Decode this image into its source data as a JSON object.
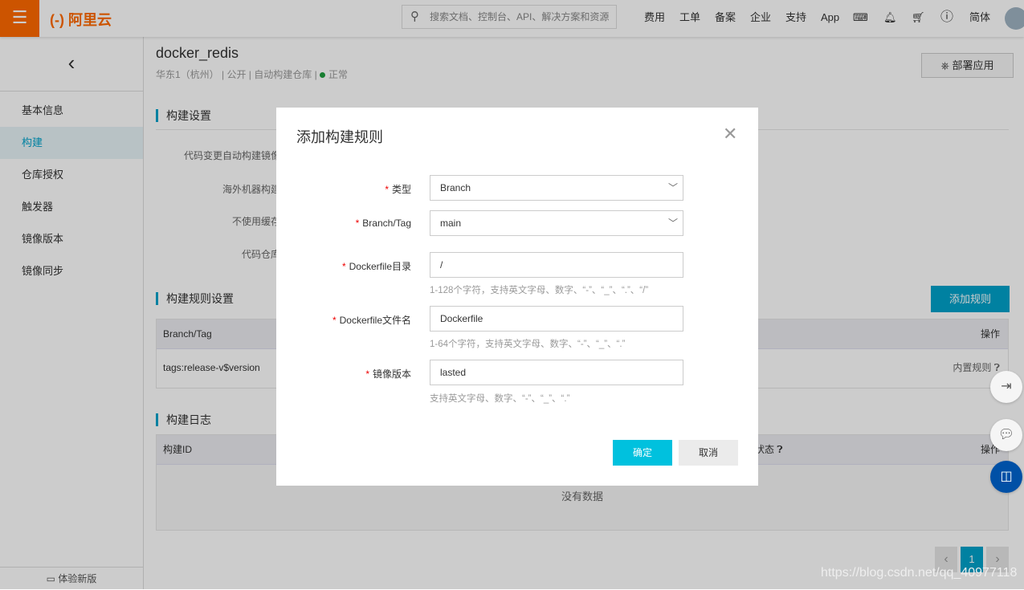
{
  "header": {
    "logo": "(-) 阿里云",
    "search_placeholder": "搜索文档、控制台、API、解决方案和资源",
    "nav": [
      "费用",
      "工单",
      "备案",
      "企业",
      "支持",
      "App"
    ],
    "lang": "简体"
  },
  "sidebar": {
    "items": [
      "基本信息",
      "构建",
      "仓库授权",
      "触发器",
      "镜像版本",
      "镜像同步"
    ],
    "active": "构建",
    "new_version": "体验新版"
  },
  "repo": {
    "name": "docker_redis",
    "meta": "华东1（杭州） | 公开 | 自动构建仓库 |",
    "status": "正常",
    "status_color": "#1e9e3e",
    "deploy": "部署应用"
  },
  "build_settings": {
    "title": "构建设置",
    "labels": [
      "代码变更自动构建镜像",
      "海外机器构建",
      "不使用缓存",
      "代码仓库"
    ]
  },
  "rules": {
    "title": "构建规则设置",
    "add": "添加规则",
    "columns": [
      "Branch/Tag",
      "操作"
    ],
    "rows": [
      {
        "branch": "tags:release-v$version",
        "op": "内置规则"
      }
    ]
  },
  "logs": {
    "title": "构建日志",
    "columns": [
      "构建ID",
      "状态",
      "操作"
    ],
    "empty": "没有数据"
  },
  "pagination": {
    "current": "1"
  },
  "watermark": "https://blog.csdn.net/qq_40977118",
  "modal": {
    "title": "添加构建规则",
    "fields": [
      {
        "label": "类型",
        "value": "Branch"
      },
      {
        "label": "Branch/Tag",
        "value": "main"
      },
      {
        "label": "Dockerfile目录",
        "value": "/",
        "hint": "1-128个字符，支持英文字母、数字、“-”、“_”、“.”、“/”"
      },
      {
        "label": "Dockerfile文件名",
        "value": "Dockerfile",
        "hint": "1-64个字符，支持英文字母、数字、“-”、“_”、“.”"
      },
      {
        "label": "镜像版本",
        "value": "lasted",
        "hint": "支持英文字母、数字、“-”、“_”、“.”"
      }
    ],
    "ok": "确定",
    "cancel": "取消"
  },
  "accent": "#00a2ca"
}
